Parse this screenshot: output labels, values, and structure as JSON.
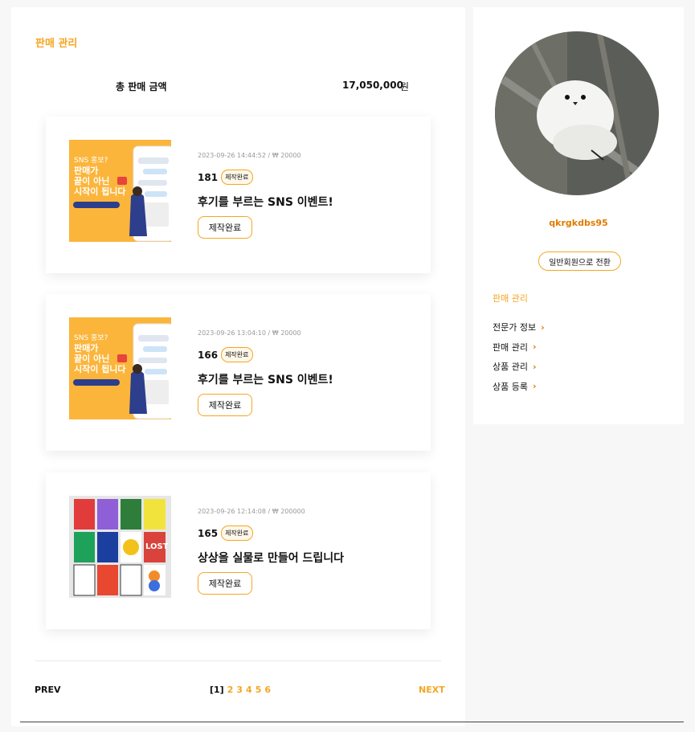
{
  "main": {
    "section_title": "판매 관리",
    "total_label": "총 판매 금액",
    "total_amount": "17,050,000",
    "total_unit": "원"
  },
  "cards": [
    {
      "image": "sns-promo-thumbnail",
      "meta": "2023-09-26 14:44:52 / ₩ 20000",
      "id": "181",
      "badge": "제작완료",
      "title": "후기를 부르는 SNS 이벤트!",
      "button": "제작완료",
      "thumb_text": [
        "SNS 홍보?",
        "판매가",
        "끝이 아닌",
        "시작이 됩니다"
      ]
    },
    {
      "image": "sns-promo-thumbnail",
      "meta": "2023-09-26 13:04:10 / ₩ 20000",
      "id": "166",
      "badge": "제작완료",
      "title": "후기를 부르는 SNS 이벤트!",
      "button": "제작완료",
      "thumb_text": [
        "SNS 홍보?",
        "판매가",
        "끝이 아닌",
        "시작이 됩니다"
      ]
    },
    {
      "image": "poster-grid-thumbnail",
      "meta": "2023-09-26 12:14:08 / ₩ 200000",
      "id": "165",
      "badge": "제작완료",
      "title": "상상을 실물로 만들어 드립니다",
      "button": "제작완료",
      "thumb_text": [
        "LOST"
      ]
    }
  ],
  "pagination": {
    "prev": "PREV",
    "current": "[1]",
    "pages": [
      "2",
      "3",
      "4",
      "5",
      "6"
    ],
    "next": "NEXT"
  },
  "sidebar": {
    "avatar": "bird-avatar",
    "username": "qkrgkdbs95",
    "switch_button": "일반회원으로 전환",
    "heading": "판매 관리",
    "menu": [
      "전문가 정보",
      "판매 관리",
      "상품 관리",
      "상품 등록"
    ]
  },
  "colors": {
    "accent": "#f5a623",
    "accent_dark": "#e07b00",
    "thumb_orange": "#fbb53b"
  }
}
